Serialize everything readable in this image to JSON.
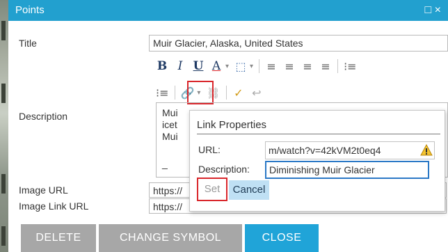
{
  "window": {
    "title": "Points",
    "controls": "□ ×"
  },
  "form": {
    "title_label": "Title",
    "title_value": "Muir Glacier, Alaska, United States",
    "description_label": "Description",
    "image_url_label": "Image URL",
    "image_url_value": "https://",
    "image_link_url_label": "Image Link URL",
    "image_link_url_value": "https://"
  },
  "toolbar": {
    "row1": [
      "B",
      "I",
      "U",
      "A",
      "▾",
      "⬚",
      "▾",
      "≡",
      "≡",
      "≡",
      "≡",
      "⁝≡"
    ],
    "row2": [
      "⁝≡",
      "🔗",
      "▾",
      "⛓",
      "✓",
      "↩"
    ]
  },
  "editor": {
    "line1": "Mui",
    "line2": "icet",
    "line3": "Mui",
    "line4": "_"
  },
  "popup": {
    "title": "Link Properties",
    "url_label": "URL:",
    "url_value": "m/watch?v=42kVM2t0eq4",
    "description_label": "Description:",
    "description_value": "Diminishing Muir Glacier",
    "set_label": "Set",
    "cancel_label": "Cancel"
  },
  "footer": {
    "delete_label": "DELETE",
    "change_symbol_label": "CHANGE SYMBOL",
    "close_label": "CLOSE"
  },
  "colors": {
    "title_bar": "#22a0cf",
    "highlight": "#d9262b",
    "footer_grey": "#a7a7a7",
    "footer_blue": "#20a4d8",
    "cancel_bg": "#bfe0f4"
  }
}
